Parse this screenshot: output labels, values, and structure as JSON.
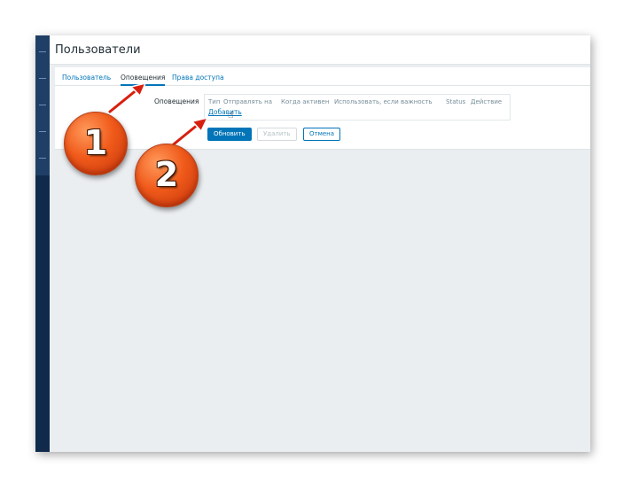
{
  "page": {
    "title": "Пользователи"
  },
  "tabs": [
    {
      "label": "Пользователь"
    },
    {
      "label": "Оповещения"
    },
    {
      "label": "Права доступа"
    }
  ],
  "media": {
    "label": "Оповещения",
    "columns": [
      "Тип",
      "Отправлять на",
      "Когда активен",
      "Использовать, если важность",
      "Status",
      "Действие"
    ],
    "add_label": "Добавить"
  },
  "buttons": {
    "update": "Обновить",
    "delete": "Удалить",
    "cancel": "Отмена"
  },
  "badges": [
    "1",
    "2"
  ],
  "colors": {
    "sidebar": "#1f3f66",
    "accent": "#0275b8",
    "badge": "#f05a1a",
    "arrow": "#d81f0f"
  }
}
